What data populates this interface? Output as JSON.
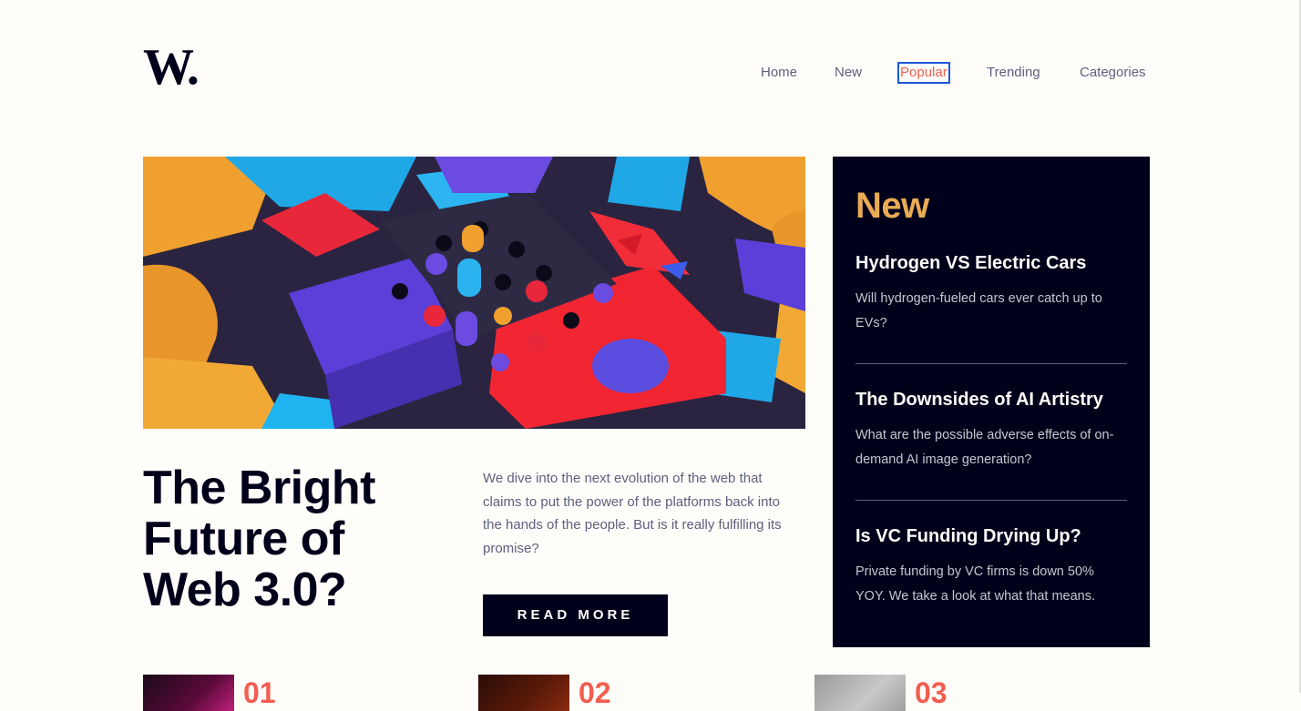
{
  "logo": {
    "text": "W."
  },
  "nav": {
    "items": [
      {
        "label": "Home"
      },
      {
        "label": "New"
      },
      {
        "label": "Popular",
        "active": true
      },
      {
        "label": "Trending"
      },
      {
        "label": "Categories"
      }
    ]
  },
  "hero": {
    "title": "The Bright Future of Web 3.0?",
    "description": "We dive into the next evolution of the web that claims to put the power of the platforms back into the hands of the people. But is it really fulfilling its promise?",
    "button_label": "READ MORE"
  },
  "new_panel": {
    "heading": "New",
    "items": [
      {
        "title": "Hydrogen VS Electric Cars",
        "text": "Will hydrogen-fueled cars ever catch up to EVs?"
      },
      {
        "title": "The Downsides of AI Artistry",
        "text": "What are the possible adverse effects of on-demand AI image generation?"
      },
      {
        "title": "Is VC Funding Drying Up?",
        "text": "Private funding by VC firms is down 50% YOY. We take a look at what that means."
      }
    ]
  },
  "bottom_list": [
    {
      "number": "01"
    },
    {
      "number": "02"
    },
    {
      "number": "03"
    }
  ],
  "colors": {
    "background": "#fffdfa",
    "dark": "#00001a",
    "accent_red": "#f15e50",
    "accent_orange": "#e9ab53",
    "muted": "#5e607e"
  }
}
